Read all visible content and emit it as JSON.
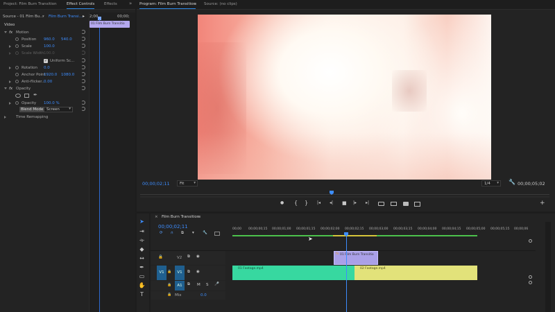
{
  "left_tabs": {
    "project": "Project: Film Burn Transition",
    "effect_controls": "Effect Controls",
    "effects": "Effects",
    "more": "»"
  },
  "source": {
    "label": "Source - 01 Film Bu...",
    "sequence": "Film Burn Transi...",
    "play": "▸",
    "time_start": "2;00",
    "time_end": "00;00;",
    "clip_label": "01 Film Burn Transitio"
  },
  "effects": {
    "video_label": "Video",
    "motion": "Motion",
    "position_label": "Position",
    "position_x": "960.0",
    "position_y": "540.0",
    "scale_label": "Scale",
    "scale_value": "100.0",
    "scale_width_label": "Scale Width",
    "scale_width_value": "100.0",
    "uniform_scale": "Uniform Sc...",
    "rotation_label": "Rotation",
    "rotation_value": "0.0",
    "anchor_label": "Anchor Point",
    "anchor_x": "1920.0",
    "anchor_y": "1080.0",
    "antiflicker_label": "Anti-flicker...",
    "antiflicker_value": "0.00",
    "opacity": "Opacity",
    "opacity_label": "Opacity",
    "opacity_value": "100.0 %",
    "blend_mode_label": "Blend Mode",
    "blend_mode_value": "Screen",
    "time_remapping": "Time Remapping"
  },
  "program": {
    "title": "Program: Film Burn Transition",
    "clips": "Source: (no clips)",
    "timecode": "00;00;02;11",
    "fit": "Fit",
    "quality": "1/4",
    "duration": "00;00;05;02"
  },
  "transport": {
    "marker": "●",
    "in": "{",
    "out": "}",
    "go_in": "|◂",
    "step_back": "◂|",
    "stop": "■",
    "step_fwd": "|▸",
    "go_out": "▸|",
    "add": "+"
  },
  "timeline": {
    "title": "Film Burn Transition",
    "timecode": "00;00;02;11",
    "ruler": [
      "00;00",
      "00;00;00;15",
      "00;00;01;00",
      "00;00;01;15",
      "00;00;02;00",
      "00;00;02;15",
      "00;00;03;00",
      "00;00;03;15",
      "00;00;04;00",
      "00;00;04;15",
      "00;00;05;00",
      "00;00;05;15",
      "00;00;06"
    ],
    "tracks": {
      "v2": "V2",
      "v1_src": "V1",
      "v1": "V1",
      "a1": "A1",
      "m": "M",
      "s": "S",
      "mix": "Mix",
      "mix_value": "0.0"
    },
    "clips": {
      "transition": "01 Film Burn Transitio",
      "footage1": "01 Footage.mp4",
      "footage2": "02 Footage.mp4"
    }
  },
  "colors": {
    "accent": "#2d8ceb",
    "clip_teal": "#37d8a0",
    "clip_yellow": "#e2e27a",
    "clip_purple": "#aaa0e8",
    "playhead": "#3d8dff"
  }
}
